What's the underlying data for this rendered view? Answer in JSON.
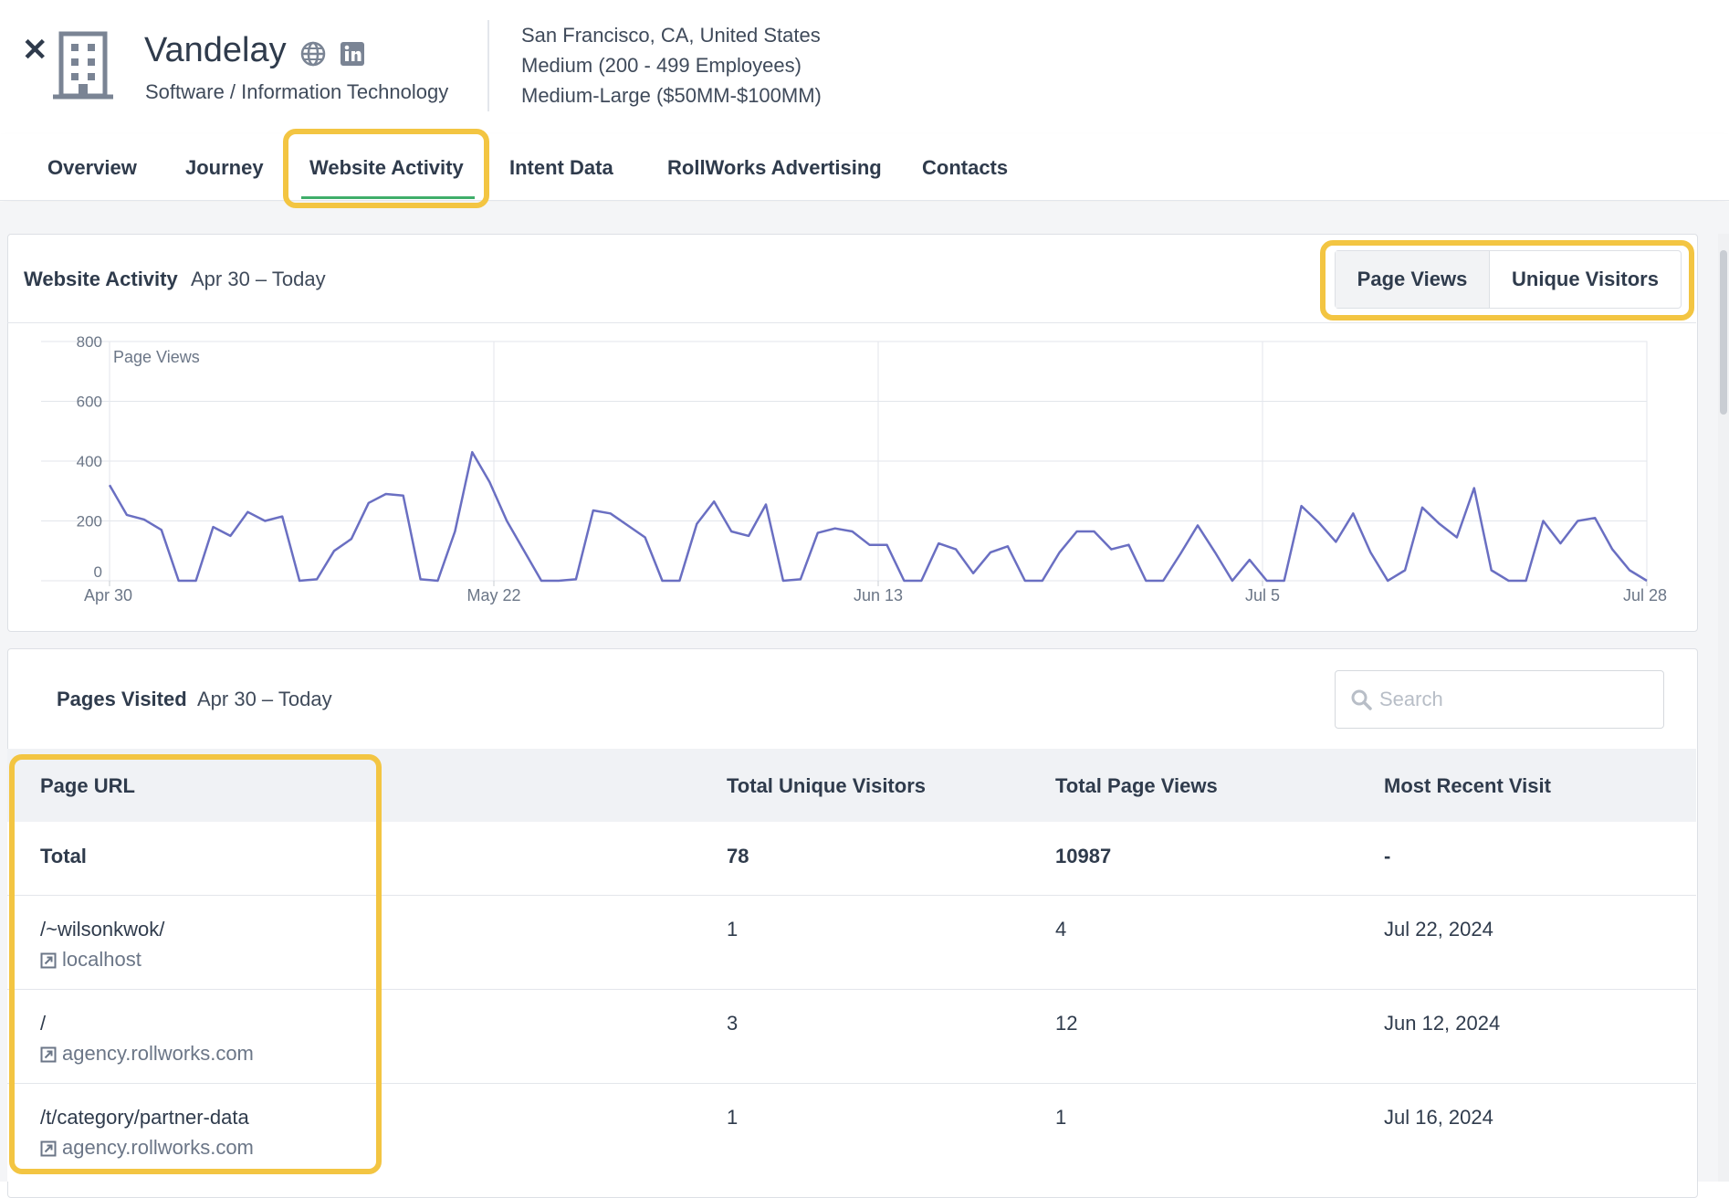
{
  "header": {
    "company_name": "Vandelay",
    "industry": "Software / Information Technology",
    "location": "San Francisco, CA, United States",
    "size": "Medium (200 - 499 Employees)",
    "revenue": "Medium-Large ($50MM-$100MM)",
    "close_glyph": "✕"
  },
  "tabs": [
    "Overview",
    "Journey",
    "Website Activity",
    "Intent Data",
    "RollWorks Advertising",
    "Contacts"
  ],
  "active_tab": "Website Activity",
  "activity": {
    "title": "Website Activity",
    "range": "Apr 30 – Today",
    "toggle": [
      "Page Views",
      "Unique Visitors"
    ],
    "selected": "Page Views"
  },
  "chart_data": {
    "type": "line",
    "series": [
      {
        "name": "Page Views",
        "values": [
          320,
          220,
          205,
          170,
          0,
          0,
          180,
          150,
          230,
          200,
          215,
          0,
          5,
          100,
          140,
          260,
          290,
          285,
          5,
          0,
          165,
          430,
          330,
          200,
          100,
          0,
          0,
          5,
          235,
          225,
          185,
          145,
          0,
          0,
          190,
          265,
          165,
          150,
          255,
          0,
          5,
          160,
          175,
          165,
          120,
          120,
          0,
          0,
          125,
          105,
          25,
          95,
          115,
          0,
          0,
          95,
          165,
          165,
          105,
          120,
          0,
          0,
          90,
          185,
          95,
          0,
          70,
          0,
          0,
          250,
          195,
          130,
          225,
          95,
          0,
          35,
          245,
          190,
          145,
          310,
          35,
          0,
          0,
          200,
          125,
          200,
          210,
          105,
          35,
          0
        ]
      }
    ],
    "x_ticks": [
      "Apr 30",
      "May 22",
      "Jun 13",
      "Jul 5",
      "Jul 28"
    ],
    "y_ticks": [
      "0",
      "200",
      "400",
      "600",
      "800"
    ],
    "ylim": [
      0,
      800
    ],
    "ylabel": "Page Views",
    "line_color": "#6a6fc2",
    "grid": true
  },
  "pages": {
    "title": "Pages Visited",
    "range": "Apr 30 – Today",
    "search_placeholder": "Search",
    "columns": [
      "Page URL",
      "Total Unique Visitors",
      "Total Page Views",
      "Most Recent Visit"
    ],
    "total": {
      "label": "Total",
      "visitors": "78",
      "views": "10987",
      "recent": "-"
    },
    "rows": [
      {
        "url": "/~wilsonkwok/",
        "domain": "localhost",
        "visitors": "1",
        "views": "4",
        "recent": "Jul 22, 2024"
      },
      {
        "url": "/",
        "domain": "agency.rollworks.com",
        "visitors": "3",
        "views": "12",
        "recent": "Jun 12, 2024"
      },
      {
        "url": "/t/category/partner-data",
        "domain": "agency.rollworks.com",
        "visitors": "1",
        "views": "1",
        "recent": "Jul 16, 2024"
      }
    ]
  },
  "colors": {
    "highlight": "#f3c542",
    "active_tab_underline": "#3fae6a",
    "text": "#2f3b4c"
  }
}
